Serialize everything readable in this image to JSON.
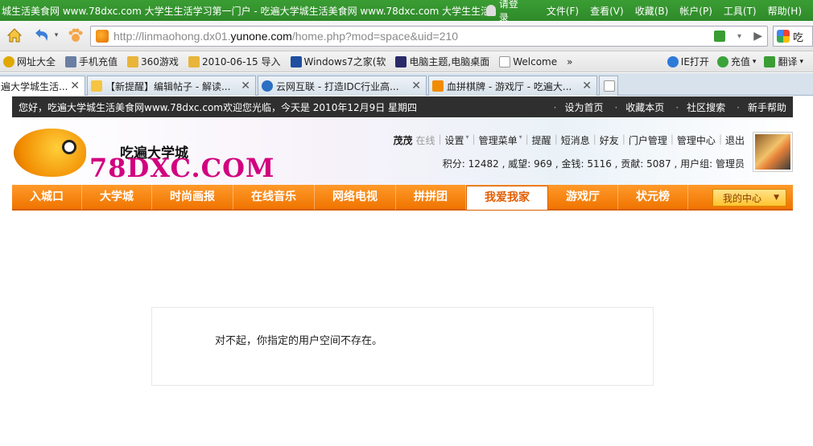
{
  "browser": {
    "title": "城生活美食网 www.78dxc.com 大学生生活学习第一门户 - 吃遍大学城生活美食网 www.78dxc.com 大学生生活...",
    "login_label": "请登录",
    "menus": [
      "文件(F)",
      "查看(V)",
      "收藏(B)",
      "帐户(P)",
      "工具(T)",
      "帮助(H)"
    ],
    "url_prefix": "http://linmaohong.dx01.",
    "url_domain": "yunone.com",
    "url_suffix": "/home.php?mod=space&uid=210",
    "search_label": "吃",
    "favorites": [
      "网址大全",
      "手机充值",
      "360游戏",
      "2010-06-15 导入",
      "Windows7之家(软",
      "电脑主题,电脑桌面",
      "Welcome",
      "»"
    ],
    "favorites_right": [
      "IE打开",
      "充值",
      "翻译"
    ],
    "tabs": [
      {
        "label": "遍大学城生活...",
        "active": true
      },
      {
        "label": "【新提醒】编辑帖子 - 解读...",
        "active": false
      },
      {
        "label": "云网互联 - 打造IDC行业高...",
        "active": false
      },
      {
        "label": "血拼棋牌 - 游戏厅 - 吃遍大...",
        "active": false
      }
    ]
  },
  "site": {
    "welcome": "您好，吃遍大学城生活美食网www.78dxc.com欢迎您光临，今天是 2010年12月9日 星期四",
    "top_links": [
      "设为首页",
      "收藏本页",
      "社区搜索",
      "新手帮助"
    ],
    "logo_cn": "吃遍大学城",
    "logo_en": "78DXC.COM",
    "user": {
      "name": "茂茂",
      "status": "在线",
      "links": [
        "设置",
        "管理菜单",
        "提醒",
        "短消息",
        "好友",
        "门户管理",
        "管理中心",
        "退出"
      ],
      "stats": "积分: 12482 , 威望: 969 , 金钱: 5116 , 贡献: 5087 , 用户组: 管理员"
    },
    "nav": [
      "入城口",
      "大学城",
      "时尚画报",
      "在线音乐",
      "网络电视",
      "拼拼团",
      "我爱我家",
      "游戏厅",
      "状元榜"
    ],
    "nav_active_index": 6,
    "my_center": "我的中心",
    "message": "对不起，你指定的用户空间不存在。"
  },
  "colors": {
    "titlebar_green": "#3a9d33",
    "nav_orange": "#f07400",
    "topbar_dark": "#2f2f2f",
    "logo_magenta": "#d2007f"
  }
}
